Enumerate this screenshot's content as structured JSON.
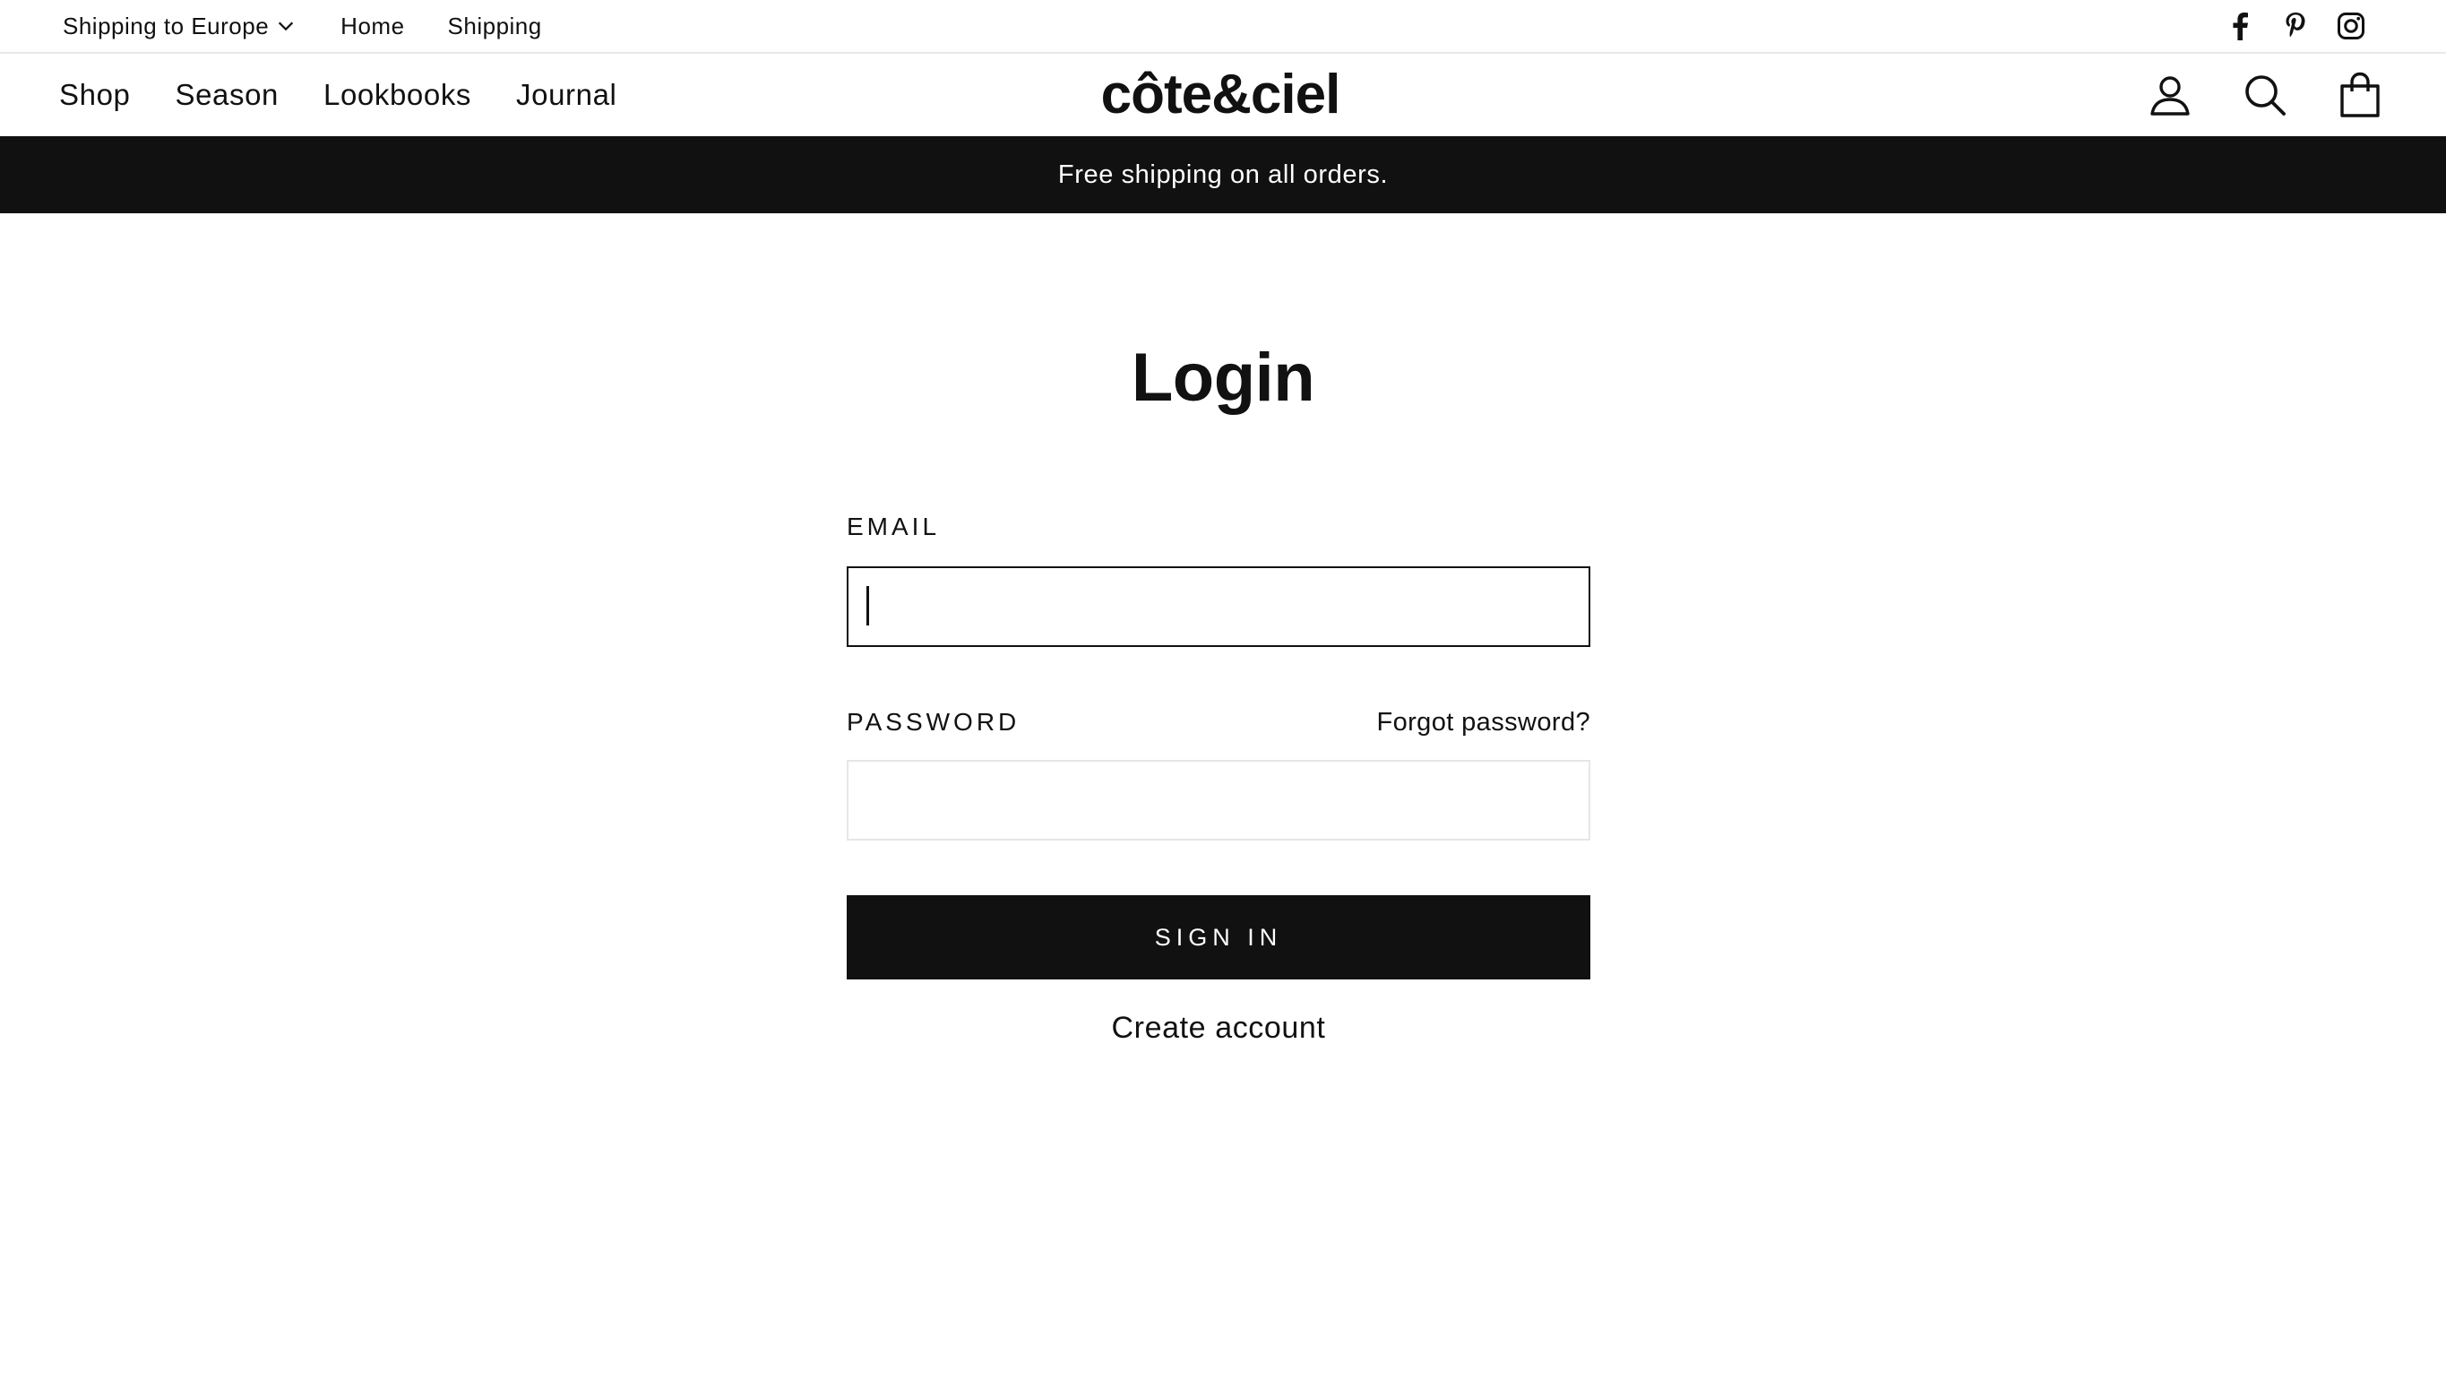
{
  "utility_bar": {
    "region_label": "Shipping to Europe",
    "links": [
      "Home",
      "Shipping"
    ],
    "social": [
      "facebook-icon",
      "pinterest-icon",
      "instagram-icon"
    ]
  },
  "header": {
    "nav": [
      "Shop",
      "Season",
      "Lookbooks",
      "Journal"
    ],
    "logo_text": "côte&ciel",
    "icons": [
      "account-icon",
      "search-icon",
      "cart-icon"
    ]
  },
  "announcement": "Free shipping on all orders.",
  "login": {
    "title": "Login",
    "email_label": "EMAIL",
    "email_value": "",
    "password_label": "PASSWORD",
    "forgot_label": "Forgot password?",
    "password_value": "",
    "submit_label": "SIGN IN",
    "create_label": "Create account"
  },
  "colors": {
    "text": "#111111",
    "announcement_bg": "#111111",
    "button_bg": "#111111",
    "border_light": "#e6e6e6"
  }
}
